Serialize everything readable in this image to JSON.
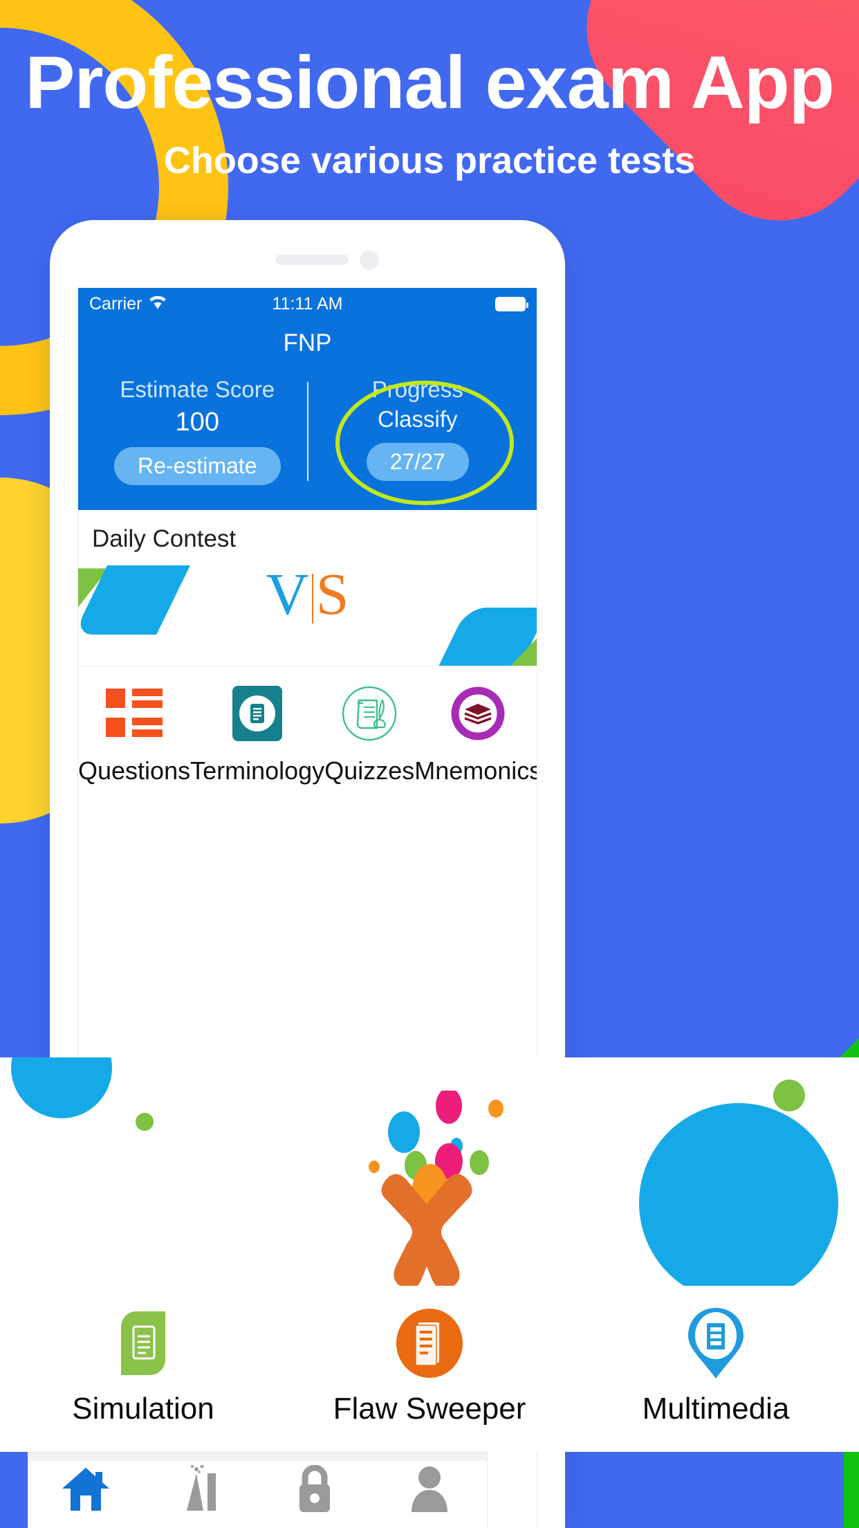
{
  "banner": {
    "title": "Professional exam App",
    "subtitle": "Choose various practice tests"
  },
  "colors": {
    "background_blue": "#4169F0",
    "app_blue": "#0A72DD",
    "accent_yellow": "#FFC314",
    "accent_red": "#FA4A67",
    "highlight_green": "#C2E81A",
    "pill_blue": "#66B5F2",
    "green_stripe": "#12C312"
  },
  "phone": {
    "statusbar": {
      "carrier": "Carrier",
      "wifi_icon": "wifi-icon",
      "time": "11:11 AM",
      "battery_icon": "battery-icon"
    },
    "app_title": "FNP",
    "stats": {
      "score": {
        "label": "Estimate Score",
        "value": "100",
        "button": "Re-estimate"
      },
      "progress": {
        "label_line1": "Progress",
        "label_line2": "Classify",
        "value": "27/27"
      }
    },
    "contest": {
      "title": "Daily Contest",
      "vs_left": "V",
      "vs_right": "S"
    },
    "features_row1": [
      {
        "label": "Questions",
        "icon": "list-blocks-icon",
        "color": "#F4511E"
      },
      {
        "label": "Terminology",
        "icon": "document-badge-icon",
        "color": "#16808C"
      },
      {
        "label": "Quizzes",
        "icon": "scroll-quill-icon",
        "color": "#3BC08A"
      },
      {
        "label": "Mnemonics",
        "icon": "layers-stack-icon",
        "color": "#A82BB5"
      }
    ],
    "features_row2": [
      {
        "label": "Simulation",
        "icon": "leaf-document-icon",
        "color": "#8BC34A"
      },
      {
        "label": "Flaw Sweeper",
        "icon": "documents-circle-icon",
        "color": "#EA6A12"
      },
      {
        "label": "Multimedia",
        "icon": "map-pin-document-icon",
        "color": "#1E9BDC"
      }
    ],
    "tabs": [
      {
        "name": "home",
        "icon": "home-icon",
        "active": true,
        "color": "#1273D4"
      },
      {
        "name": "flask",
        "icon": "erupting-flask-icon",
        "active": false,
        "color": "#9A9A9A"
      },
      {
        "name": "lock",
        "icon": "lock-icon",
        "active": false,
        "color": "#9A9A9A"
      },
      {
        "name": "profile",
        "icon": "person-icon",
        "active": false,
        "color": "#9A9A9A"
      }
    ]
  },
  "illustration": {
    "name": "juggler-figure",
    "body_color": "#E2702A",
    "ball_colors": [
      "#F7931E",
      "#EC1E79",
      "#16A9E8",
      "#7DC242"
    ]
  }
}
